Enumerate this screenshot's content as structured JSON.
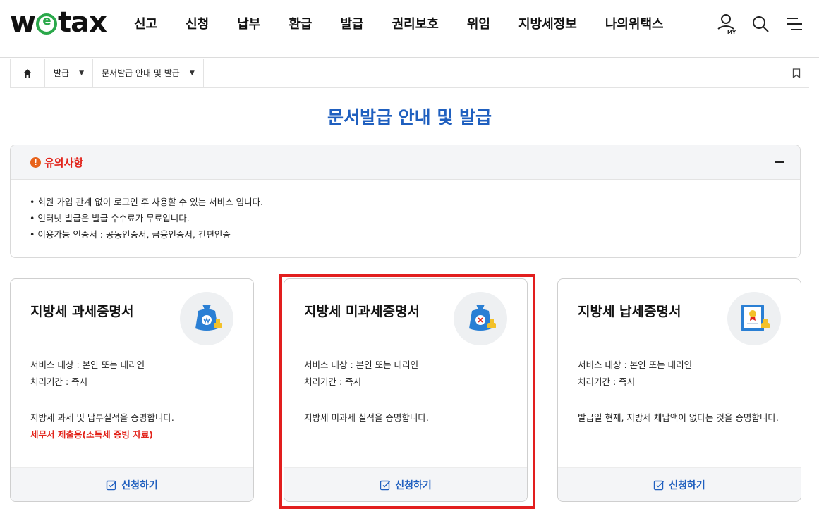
{
  "header": {
    "logo": {
      "part1": "w",
      "part2": "e",
      "part3": "tax",
      "brand_color": "#2aa84a"
    },
    "nav": [
      "신고",
      "신청",
      "납부",
      "환급",
      "발급",
      "권리보호",
      "위임",
      "지방세정보",
      "나의위택스"
    ],
    "icons": [
      "my-user-icon",
      "search-icon",
      "menu-icon"
    ],
    "my_badge": "MY"
  },
  "breadcrumb": {
    "items": [
      "발급",
      "문서발급 안내 및 발급"
    ],
    "caret": "▼"
  },
  "page": {
    "title": "문서발급 안내 및 발급",
    "accent": "#1f5fbf"
  },
  "notice": {
    "icon": "!",
    "title": "유의사항",
    "lines": [
      "• 회원 가입 관계 없이 로그인 후 사용할 수 있는 서비스 입니다.",
      "• 인터넷 발급은 발급 수수료가 무료입니다.",
      "• 이용가능 인증서 : 공동인증서, 금융인증서, 간편인증"
    ]
  },
  "cards": [
    {
      "title": "지방세 과세증명서",
      "illust": "tax-bag-won-icon",
      "target": "서비스 대상 : 본인 또는 대리인",
      "period": "처리기간 : 즉시",
      "desc": "지방세 과세 및 납부실적을 증명합니다.",
      "note": "세무서 제출용(소득세 증빙 자료)",
      "apply": "신청하기"
    },
    {
      "title": "지방세 미과세증명서",
      "illust": "tax-bag-x-icon",
      "target": "서비스 대상 : 본인 또는 대리인",
      "period": "처리기간 : 즉시",
      "desc": "지방세 미과세 실적을 증명합니다.",
      "note": "",
      "apply": "신청하기"
    },
    {
      "title": "지방세 납세증명서",
      "illust": "certificate-icon",
      "target": "서비스 대상 : 본인 또는 대리인",
      "period": "처리기간 : 즉시",
      "desc": "발급일 현재, 지방세 체납액이 없다는 것을 증명합니다.",
      "note": "",
      "apply": "신청하기"
    }
  ],
  "highlight_color": "#e21e1e"
}
